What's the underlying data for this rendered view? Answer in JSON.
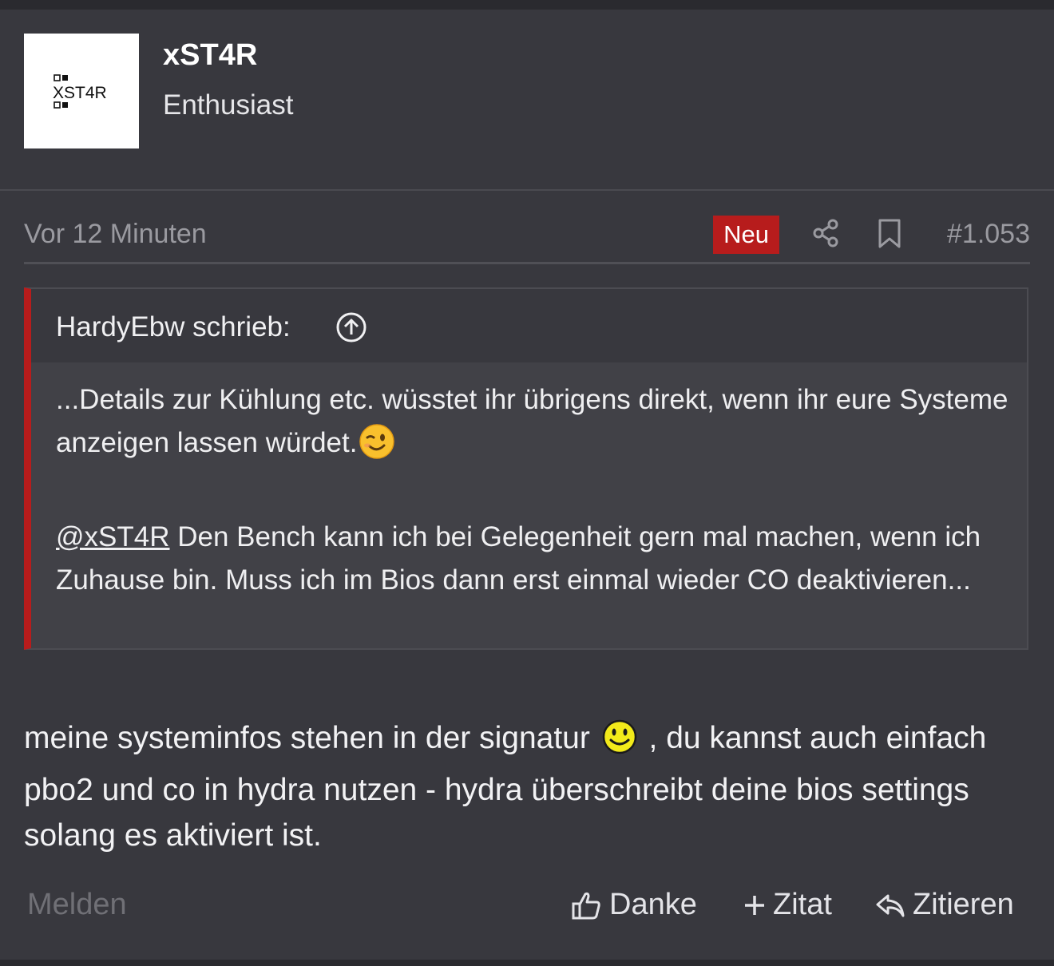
{
  "user": {
    "name": "xST4R",
    "title": "Enthusiast",
    "avatar_text": "XST4R"
  },
  "meta": {
    "time": "Vor 12 Minuten",
    "badge": "Neu",
    "badge_color": "#b71c1c",
    "post_number": "#1.053",
    "icons": [
      "share-icon",
      "bookmark-icon"
    ]
  },
  "quote": {
    "author": "HardyEbw schrieb:",
    "line1": "...Details zur Kühlung etc. wüsstet ihr übrigens direkt, wenn ihr eure Systeme anzeigen lassen würdet.",
    "line1_emoji": "winking-face-emoji",
    "mention": "@xST4R",
    "line2": " Den Bench kann ich bei Gelegenheit gern mal machen, wenn ich Zuhause bin. Muss ich im Bios dann erst einmal wieder CO deaktivieren..."
  },
  "message": {
    "part1": "meine systeminfos stehen in der signatur ",
    "emoji": "smiley-emoji",
    "part2": " , du kannst auch einfach pbo2 und co in hydra nutzen - hydra überschreibt deine bios settings solang es aktiviert ist."
  },
  "actions": {
    "report": "Melden",
    "like": "Danke",
    "add_quote": "Zitat",
    "reply": "Zitieren"
  }
}
